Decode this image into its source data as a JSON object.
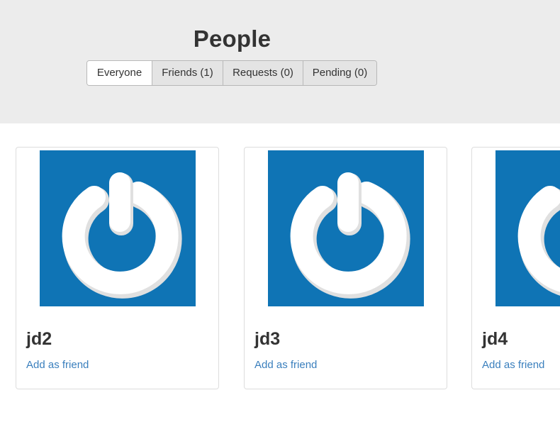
{
  "page": {
    "title": "People"
  },
  "tabs": [
    {
      "label": "Everyone",
      "active": true
    },
    {
      "label": "Friends (1)",
      "active": false
    },
    {
      "label": "Requests (0)",
      "active": false
    },
    {
      "label": "Pending (0)",
      "active": false
    }
  ],
  "people": [
    {
      "username": "jd2",
      "action_label": "Add as friend",
      "avatar_icon": "gravatar-power-icon"
    },
    {
      "username": "jd3",
      "action_label": "Add as friend",
      "avatar_icon": "gravatar-power-icon"
    },
    {
      "username": "jd4",
      "action_label": "Add as friend",
      "avatar_icon": "gravatar-power-icon"
    }
  ],
  "colors": {
    "header_background": "#ececec",
    "avatar_background": "#0f74b5",
    "link": "#3a7fbd"
  }
}
